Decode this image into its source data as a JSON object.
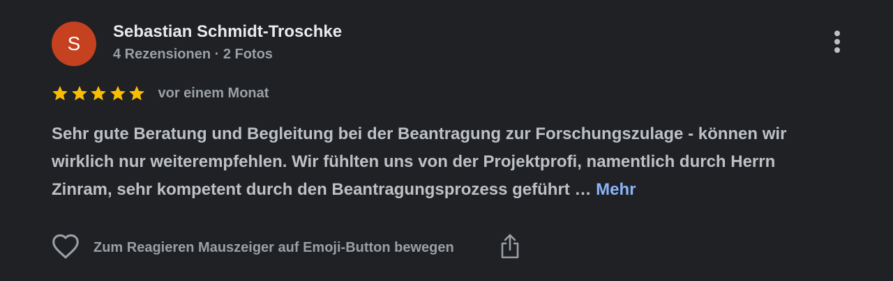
{
  "reviewer": {
    "avatar_letter": "S",
    "avatar_color": "#c5411f",
    "name": "Sebastian Schmidt-Troschke",
    "meta": "4 Rezensionen · 2 Fotos"
  },
  "more_options_icon": "vertical-dots-icon",
  "review": {
    "rating": 5,
    "max_rating": 5,
    "star_color": "#fbbc04",
    "date": "vor einem Monat",
    "text_lines": [
      "Sehr gute Beratung und Begleitung bei der Beantragung zur Forschungszulage - können wir",
      "wirklich nur weiterempfehlen. Wir fühlten uns von der Projektprofi, namentlich durch Herrn",
      "Zinram, sehr kompetent durch den Beantragungsprozess geführt …"
    ],
    "more_label": "Mehr",
    "link_color": "#8ab4f8"
  },
  "actions": {
    "react_icon": "heart-outline-icon",
    "react_hint": "Zum Reagieren Mauszeiger auf Emoji-Button bewegen",
    "share_icon": "share-icon"
  }
}
